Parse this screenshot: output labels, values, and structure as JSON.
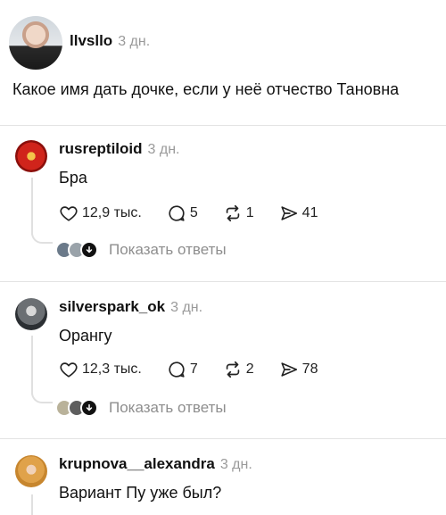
{
  "post": {
    "username": "llvsllo",
    "time": "3 дн.",
    "text": "Какое имя дать дочке, если у неё отчество Тановна"
  },
  "comments": [
    {
      "username": "rusreptiloid",
      "time": "3 дн.",
      "text": "Бра",
      "likes": "12,9 тыс.",
      "replies_count": "5",
      "reposts": "1",
      "shares": "41",
      "show_replies": "Показать ответы"
    },
    {
      "username": "silverspark_ok",
      "time": "3 дн.",
      "text": "Орангу",
      "likes": "12,3 тыс.",
      "replies_count": "7",
      "reposts": "2",
      "shares": "78",
      "show_replies": "Показать ответы"
    },
    {
      "username": "krupnova__alexandra",
      "time": "3 дн.",
      "text": "Вариант Пу уже был?"
    }
  ],
  "icons": {
    "like": "heart-icon",
    "reply": "comment-bubble-icon",
    "repost": "repost-icon",
    "share": "send-icon",
    "show_replies": "arrow-down-icon"
  },
  "colors": {
    "username": "#111111",
    "timestamp": "#9a9a9a",
    "muted_link": "#8e8e8e",
    "divider": "#e3e3e3"
  }
}
